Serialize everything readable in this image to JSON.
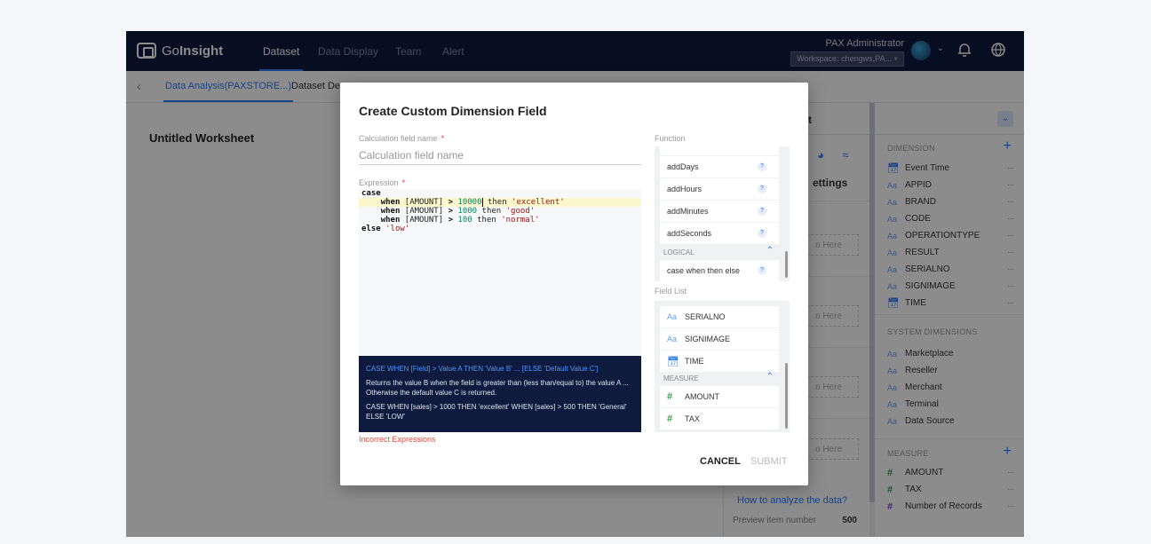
{
  "app": {
    "logo_prefix": "Go",
    "logo_suffix": "Insight",
    "nav": [
      "Dataset",
      "Data Display",
      "Team",
      "Alert"
    ],
    "user_name": "PAX Administrator",
    "workspace_label": "Workspace:",
    "workspace_value": "chengws,PA...",
    "subtabs": [
      "Data Analysis(PAXSTORE...)",
      "Dataset Det"
    ],
    "worksheet_title": "Untitled Worksheet",
    "settings_partial": "t",
    "settings_label": "ettings",
    "dropzone_text": "o Here",
    "how_link": "How to analyze the data?",
    "preview_label": "Preview item number",
    "preview_value": "500",
    "icons": [
      "back-icon",
      "bell-icon",
      "globe-icon",
      "avatar",
      "chevron-down-icon"
    ]
  },
  "fields_panel": {
    "dimension_label": "DIMENSION",
    "dimensions": [
      {
        "type": "date",
        "name": "Event Time"
      },
      {
        "type": "text",
        "name": "APPID"
      },
      {
        "type": "text",
        "name": "BRAND"
      },
      {
        "type": "text",
        "name": "CODE"
      },
      {
        "type": "text",
        "name": "OPERATIONTYPE"
      },
      {
        "type": "text",
        "name": "RESULT"
      },
      {
        "type": "text",
        "name": "SERIALNO"
      },
      {
        "type": "text",
        "name": "SIGNIMAGE"
      },
      {
        "type": "date",
        "name": "TIME"
      }
    ],
    "system_label": "SYSTEM DIMENSIONS",
    "system_dimensions": [
      "Marketplace",
      "Reseller",
      "Merchant",
      "Terminal",
      "Data Source"
    ],
    "measure_label": "MEASURE",
    "measures": [
      "AMOUNT",
      "TAX",
      "Number of Records"
    ],
    "more_glyph": "···",
    "plus_glyph": "+"
  },
  "modal": {
    "title": "Create Custom Dimension Field",
    "calc_name_label": "Calculation field name",
    "calc_name_placeholder": "Calculation field name",
    "required_mark": "*",
    "expression_label": "Expression",
    "expression": {
      "l1": "case",
      "l2_indent": "    ",
      "when": "when",
      "then": "then",
      "field": "[AMOUNT]",
      "gt": ">",
      "v1": "10000",
      "s1": "'excellent'",
      "v2": "1000",
      "s2": "'good'",
      "v3": "100",
      "s3": "'normal'",
      "else": "else",
      "s4": "'low'"
    },
    "help_title": "CASE WHEN [Field] > Value A THEN 'Value B' ... [ELSE 'Default Value C']",
    "help_desc": "Returns the value B when the field is greater than (less than/equal to) the value A ... Otherwise the default value C is returned.",
    "help_example": "CASE WHEN [sales] > 1000 THEN 'excellent' WHEN [sales] > 500 THEN 'General' ELSE 'LOW'",
    "error_text": "Incorrect Expressions",
    "function_label": "Function",
    "functions": [
      "addDays",
      "addHours",
      "addMinutes",
      "addSeconds"
    ],
    "logical_label": "LOGICAL",
    "logical_functions": [
      "case when then else"
    ],
    "field_list_label": "Field List",
    "field_list": [
      {
        "type": "text",
        "name": "SERIALNO"
      },
      {
        "type": "text",
        "name": "SIGNIMAGE"
      },
      {
        "type": "date",
        "name": "TIME"
      }
    ],
    "measure_label": "MEASURE",
    "measure_fields": [
      "AMOUNT",
      "TAX"
    ],
    "help_glyph": "?",
    "cancel_label": "CANCEL",
    "submit_label": "SUBMIT"
  }
}
